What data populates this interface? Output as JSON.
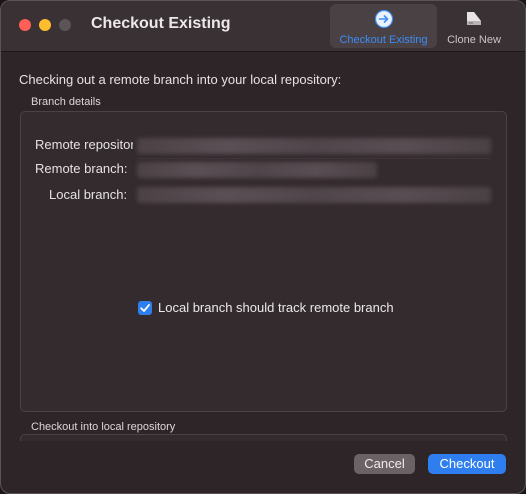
{
  "window": {
    "title": "Checkout Existing"
  },
  "toolbar": {
    "tabs": [
      {
        "label": "Checkout Existing",
        "icon": "arrow-right-circle-icon",
        "active": true
      },
      {
        "label": "Clone New",
        "icon": "drive-icon",
        "active": false
      }
    ]
  },
  "main": {
    "intro": "Checking out a remote branch into your local repository:",
    "branch_details": {
      "title": "Branch details",
      "remote_repository_label": "Remote repository:",
      "remote_branch_label": "Remote branch:",
      "local_branch_label": "Local branch:"
    },
    "track_checkbox": {
      "label": "Local branch should track remote branch",
      "checked": true
    },
    "checkout_into": {
      "title": "Checkout into local repository"
    }
  },
  "buttons": {
    "cancel": "Cancel",
    "checkout": "Checkout"
  },
  "colors": {
    "accent": "#2f7ef0",
    "window_bg": "#2e2529",
    "close": "#ff5f57",
    "minimize": "#febc2e"
  }
}
